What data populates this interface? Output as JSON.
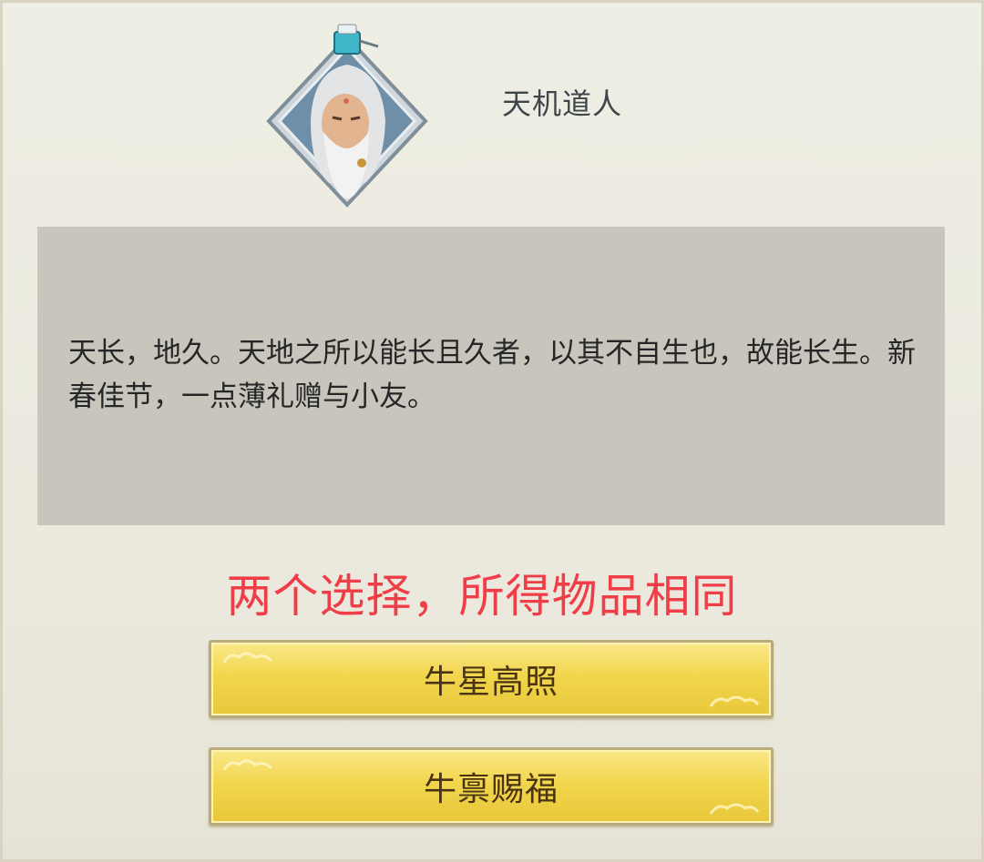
{
  "npc": {
    "name": "天机道人",
    "portrait_icon": "old-sage-portrait-icon"
  },
  "dialog": {
    "text": "天长，地久。天地之所以能长且久者，以其不自生也，故能长生。新春佳节，一点薄礼赠与小友。"
  },
  "hint": {
    "text": "两个选择，所得物品相同",
    "color": "#f03e48"
  },
  "choices": [
    {
      "label": "牛星高照"
    },
    {
      "label": "牛禀赐福"
    }
  ],
  "colors": {
    "background": "#eceadf",
    "dialog_box": "#c8c6bc",
    "button_gold": "#f1d64d",
    "button_text": "#4a3312"
  }
}
